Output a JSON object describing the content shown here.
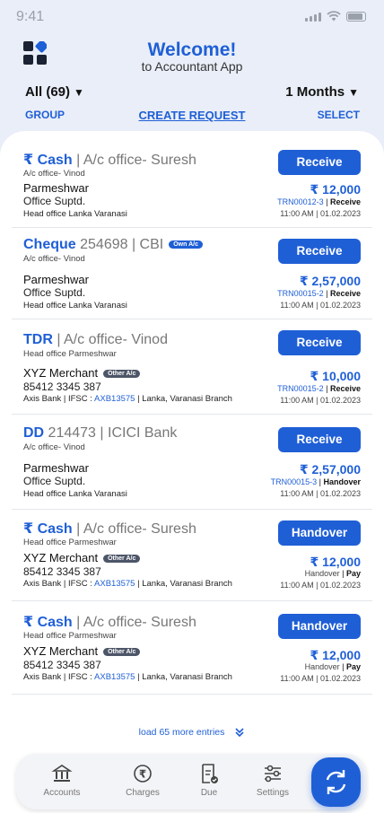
{
  "status": {
    "time": "9:41"
  },
  "header": {
    "title": "Welcome!",
    "subtitle": "to Accountant App"
  },
  "filters": {
    "left": "All (69)",
    "right": "1 Months"
  },
  "links": {
    "group": "GROUP",
    "create": "CREATE REQUEST",
    "select": "SELECT"
  },
  "entries": [
    {
      "type": "₹ Cash",
      "type_rest": " | A/c office- Suresh",
      "sub": "A/c office- Vinod",
      "name": "Parmeshwar",
      "badge": "",
      "desig": "Office Suptd.",
      "foot": "Head office Lanka Varanasi",
      "button": "Receive",
      "amount": "₹ 12,000",
      "trn": "TRN00012-3",
      "status": "Receive",
      "time": "11:00 AM | 01.02.2023"
    },
    {
      "type": "Cheque",
      "type_rest": "  254698 | CBI",
      "sub": "A/c office- Vinod",
      "name": "Parmeshwar",
      "badge": "Own A/c",
      "desig": "Office Suptd.",
      "foot": "Head office Lanka Varanasi",
      "button": "Receive",
      "amount": "₹ 2,57,000",
      "trn": "TRN00015-2",
      "status": "Receive",
      "time": "11:00 AM | 01.02.2023"
    },
    {
      "type": "TDR",
      "type_rest": "  | A/c office- Vinod",
      "sub": "Head office Parmeshwar",
      "name": "XYZ Merchant",
      "badge": "Other A/c",
      "desig": "85412 3345 387",
      "foot_bank": "Axis Bank | IFSC : ",
      "ifsc": "AXB13575",
      "foot_branch": " | Lanka, Varanasi Branch",
      "button": "Receive",
      "amount": "₹ 10,000",
      "trn": "TRN00015-2",
      "status": "Receive",
      "time": "11:00 AM | 01.02.2023"
    },
    {
      "type": "DD",
      "type_rest": "  214473 | ICICI Bank",
      "sub": "A/c office- Vinod",
      "name": "Parmeshwar",
      "badge": "",
      "desig": "Office Suptd.",
      "foot": "Head office Lanka Varanasi",
      "button": "Receive",
      "amount": "₹ 2,57,000",
      "trn": "TRN00015-3",
      "status": "Handover",
      "time": "11:00 AM | 01.02.2023"
    },
    {
      "type": "₹ Cash",
      "type_rest": " | A/c office- Suresh",
      "sub": "Head office Parmeshwar",
      "name": "XYZ Merchant",
      "badge": "Other A/c",
      "desig": "85412 3345 387",
      "foot_bank": "Axis Bank | IFSC : ",
      "ifsc": "AXB13575",
      "foot_branch": " | Lanka, Varanasi Branch",
      "button": "Handover",
      "amount": "₹ 12,000",
      "trn": "Handover",
      "status": "Pay",
      "time": "11:00 AM | 01.02.2023"
    },
    {
      "type": "₹ Cash",
      "type_rest": " | A/c office- Suresh",
      "sub": "Head office Parmeshwar",
      "name": "XYZ Merchant",
      "badge": "Other A/c",
      "desig": "85412 3345 387",
      "foot_bank": "Axis Bank | IFSC : ",
      "ifsc": "AXB13575",
      "foot_branch": " | Lanka, Varanasi Branch",
      "button": "Handover",
      "amount": "₹ 12,000",
      "trn": "Handover",
      "status": "Pay",
      "time": "11:00 AM | 01.02.2023"
    }
  ],
  "load_more": "load 65 more entries",
  "nav": [
    {
      "label": "Accounts",
      "icon": "bank-icon"
    },
    {
      "label": "Charges",
      "icon": "rupee-coin-icon"
    },
    {
      "label": "Due",
      "icon": "fees-receipt-icon"
    },
    {
      "label": "Settings",
      "icon": "sliders-icon"
    }
  ],
  "fab_icon": "exchange-icon",
  "colors": {
    "accent": "#1f5fd6",
    "badge": "#4d5668",
    "background": "#e9eef8"
  }
}
